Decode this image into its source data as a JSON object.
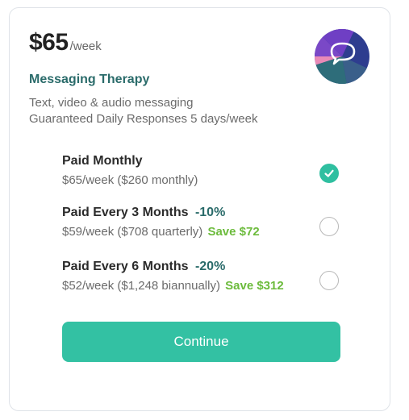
{
  "plan": {
    "price": "$65",
    "price_unit": "/week",
    "name": "Messaging Therapy",
    "features": [
      "Text, video & audio messaging",
      "Guaranteed Daily Responses 5 days/week"
    ]
  },
  "options": [
    {
      "title": "Paid Monthly",
      "discount": "",
      "subtitle": "$65/week ($260 monthly)",
      "save": "",
      "selected": true
    },
    {
      "title": "Paid Every 3 Months",
      "discount": "-10%",
      "subtitle": "$59/week ($708 quarterly)",
      "save": "Save $72",
      "selected": false
    },
    {
      "title": "Paid Every 6 Months",
      "discount": "-20%",
      "subtitle": "$52/week ($1,248 biannually)",
      "save": "Save $312",
      "selected": false
    }
  ],
  "continue_label": "Continue",
  "colors": {
    "accent": "#33c1a3",
    "plan_name": "#2a6b6a",
    "save": "#6cbb3c"
  }
}
